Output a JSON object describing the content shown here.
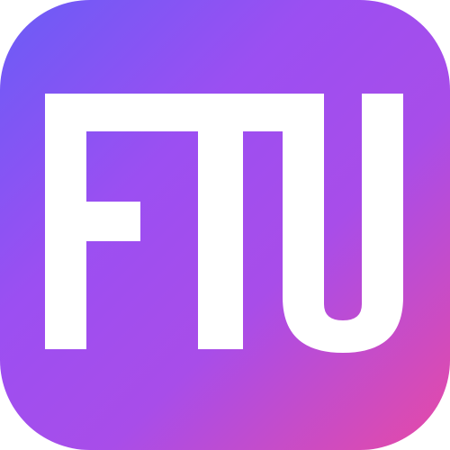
{
  "icon": {
    "logo_text": "FTU",
    "colors": {
      "gradient_start": "#6a5cf6",
      "gradient_mid": "#a84de9",
      "gradient_end": "#e64aa6",
      "letters": "#ffffff"
    }
  }
}
